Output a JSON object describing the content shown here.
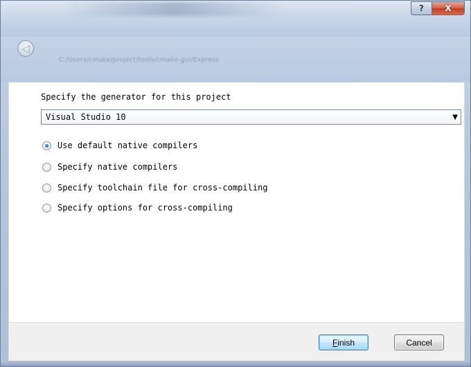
{
  "window": {
    "caption_help": "?",
    "caption_close": "X",
    "path_text": "C:/Users/cmake/project/tools/cmake-gui/Express"
  },
  "nav": {
    "back_glyph": "◁"
  },
  "generator": {
    "prompt": "Specify the generator for this project",
    "selected": "Visual Studio 10",
    "arrow": "▼"
  },
  "compiler_options": [
    {
      "label": "Use default native compilers",
      "checked": true
    },
    {
      "label": "Specify native compilers",
      "checked": false
    },
    {
      "label": "Specify toolchain file for cross-compiling",
      "checked": false
    },
    {
      "label": "Specify options for cross-compiling",
      "checked": false
    }
  ],
  "buttons": {
    "finish_accel": "F",
    "finish_rest": "inish",
    "cancel": "Cancel"
  },
  "colors": {
    "accent_radio": "#1e64b4",
    "close_button": "#c23d22",
    "default_button_border": "#3c7fb1"
  }
}
